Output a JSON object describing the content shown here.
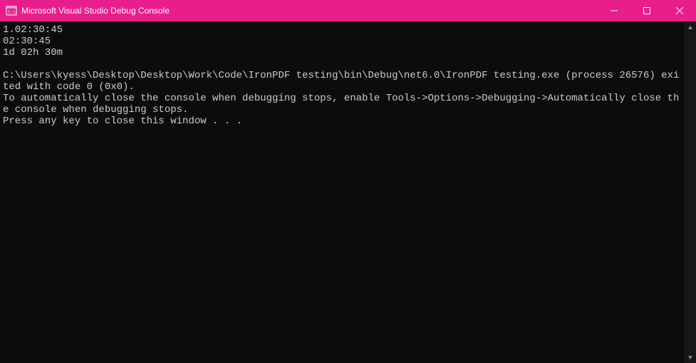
{
  "titlebar": {
    "title": "Microsoft Visual Studio Debug Console"
  },
  "console": {
    "lines": [
      "1.02:30:45",
      "02:30:45",
      "1d 02h 30m",
      "",
      "C:\\Users\\kyess\\Desktop\\Desktop\\Work\\Code\\IronPDF testing\\bin\\Debug\\net6.0\\IronPDF testing.exe (process 26576) exited with code 0 (0x0).",
      "To automatically close the console when debugging stops, enable Tools->Options->Debugging->Automatically close the console when debugging stops.",
      "Press any key to close this window . . ."
    ]
  }
}
